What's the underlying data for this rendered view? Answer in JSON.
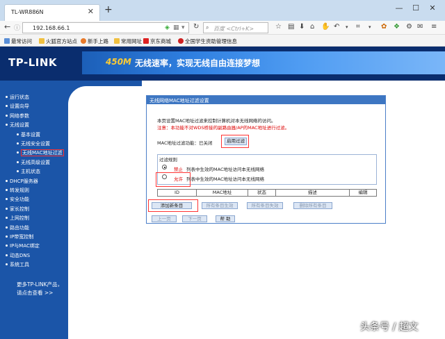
{
  "browser": {
    "tab_title": "TL-WR886N",
    "tab_close": "✕",
    "new_tab": "+",
    "url": "192.168.66.1",
    "search_placeholder": "百度 <Ctrl+K>",
    "bookmarks": [
      "最常访问",
      "火狐官方站点",
      "新手上路",
      "常用网址",
      "京东商城",
      "全国学生资助管理信息"
    ]
  },
  "banner": {
    "logo": "TP-LINK",
    "slogan_number": "450M",
    "slogan": "无线速率，实现无线自由连接梦想"
  },
  "sidebar": {
    "items": [
      {
        "label": "运行状态",
        "sub": false
      },
      {
        "label": "设置向导",
        "sub": false
      },
      {
        "label": "网络参数",
        "sub": false
      },
      {
        "label": "无线设置",
        "sub": false
      },
      {
        "label": "基本设置",
        "sub": true
      },
      {
        "label": "无线安全设置",
        "sub": true
      },
      {
        "label": "无线MAC地址过滤",
        "sub": true,
        "active": true
      },
      {
        "label": "无线高级设置",
        "sub": true
      },
      {
        "label": "主机状态",
        "sub": true
      },
      {
        "label": "DHCP服务器",
        "sub": false
      },
      {
        "label": "转发规则",
        "sub": false
      },
      {
        "label": "安全功能",
        "sub": false
      },
      {
        "label": "家长控制",
        "sub": false
      },
      {
        "label": "上网控制",
        "sub": false
      },
      {
        "label": "路由功能",
        "sub": false
      },
      {
        "label": "IP带宽控制",
        "sub": false
      },
      {
        "label": "IP与MAC绑定",
        "sub": false
      },
      {
        "label": "动态DNS",
        "sub": false
      },
      {
        "label": "系统工具",
        "sub": false
      }
    ],
    "more_line1": "更多TP-LINK产品，",
    "more_line2": "请点击查看 >>"
  },
  "panel": {
    "title": "无线网络MAC地址过滤设置",
    "desc": "本页设置MAC地址过滤来控制计算机对本无线网络的访问。",
    "note": "注意：本功能不对WDS桥接的副路由器/AP的MAC地址进行过滤。",
    "status_label": "MAC地址过滤功能：已关闭",
    "enable_button": "启用过滤",
    "rules_title": "过滤规则",
    "deny_label": "禁止",
    "deny_text": "列表中生效的MAC地址访问本无线网络",
    "allow_label": "允许",
    "allow_text": "列表中生效的MAC地址访问本无线网络",
    "columns": [
      "ID",
      "MAC地址",
      "状态",
      "描述",
      "编辑"
    ],
    "actions": [
      "添加新条目",
      "所有条目生效",
      "所有条目失效",
      "删除所有条目"
    ],
    "nav": [
      "上一页",
      "下一页",
      "帮 助"
    ]
  },
  "watermark": "头条号 / 超文"
}
